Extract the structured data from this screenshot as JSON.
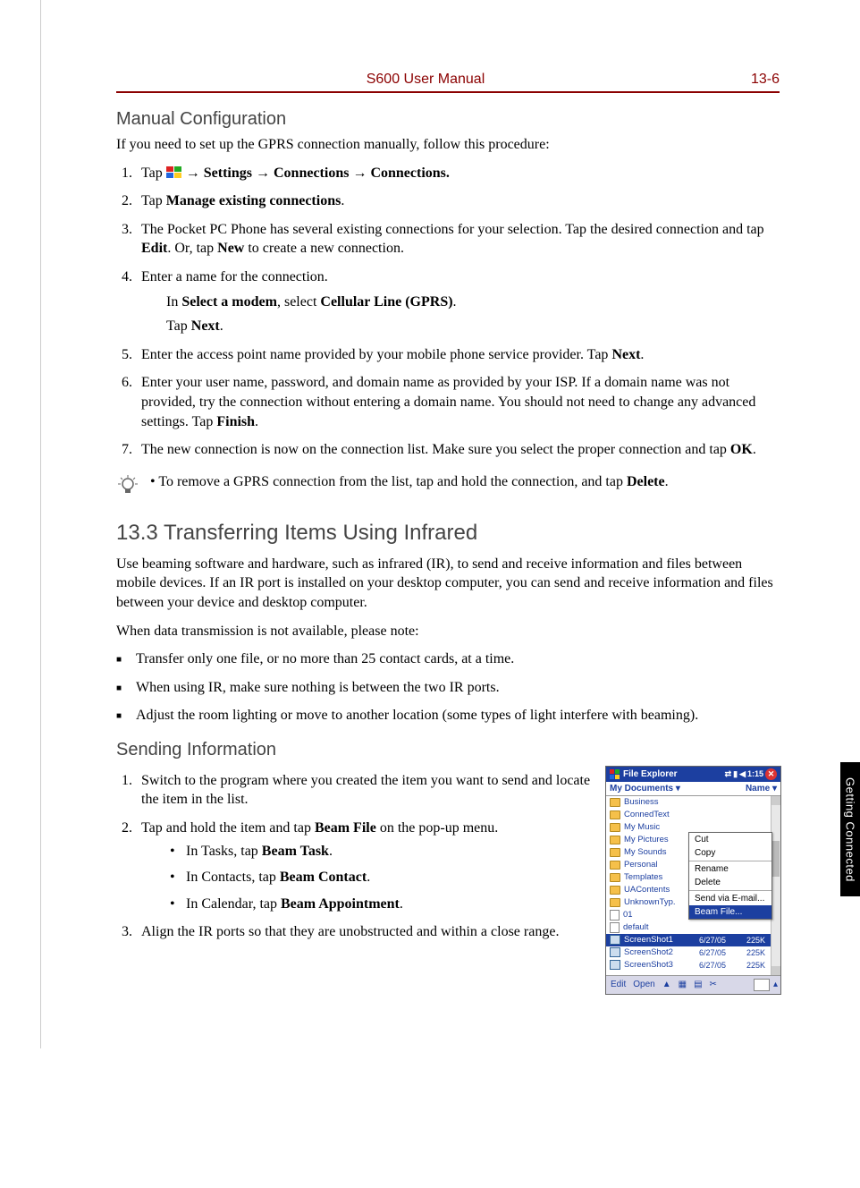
{
  "header": {
    "title": "S600 User Manual",
    "page": "13-6"
  },
  "side_tab": "Getting Connected",
  "manual_config": {
    "heading": "Manual Configuration",
    "intro": "If you need to set up the GPRS connection manually, follow this procedure:",
    "steps": {
      "s1_pre": "Tap ",
      "s1_post": " → Settings → Connections → Connections.",
      "s2_pre": "Tap ",
      "s2_bold": "Manage existing connections",
      "s2_post": ".",
      "s3a": "The Pocket PC Phone has several existing connections for your selection. Tap the desired connection and tap ",
      "s3b": "Edit",
      "s3c": ". Or, tap ",
      "s3d": "New",
      "s3e": " to create a new connection.",
      "s4": "Enter a name for the connection.",
      "s4_in1a": "In ",
      "s4_in1b": "Select a modem",
      "s4_in1c": ", select ",
      "s4_in1d": "Cellular Line (GPRS)",
      "s4_in1e": ".",
      "s4_in2a": "Tap ",
      "s4_in2b": "Next",
      "s4_in2c": ".",
      "s5a": "Enter the access point name provided by your mobile phone service provider. Tap ",
      "s5b": "Next",
      "s5c": ".",
      "s6a": "Enter your user name, password, and domain name as provided by your ISP. If a domain name was not provided, try the connection without entering a domain name. You should not need to change any advanced settings. Tap ",
      "s6b": "Finish",
      "s6c": ".",
      "s7a": "The new connection is now on the connection list. Make sure you select the proper connection and tap ",
      "s7b": "OK",
      "s7c": "."
    },
    "tip_a": "•    To remove a GPRS connection from the list, tap and hold the connection, and tap ",
    "tip_b": "Delete",
    "tip_c": "."
  },
  "section13_3": {
    "heading": "13.3    Transferring Items Using Infrared",
    "p1": "Use beaming software and hardware, such as infrared (IR), to send and receive information and files between mobile devices. If an IR port is installed on your desktop computer, you can send and receive information and files between your device and desktop computer.",
    "p2": "When data transmission is not available, please note:",
    "bullets": [
      "Transfer only one file, or no more than 25 contact cards, at a time.",
      "When using IR, make sure nothing is between the two IR ports.",
      "Adjust the room lighting or move to another location (some types of light interfere with beaming)."
    ]
  },
  "sending": {
    "heading": "Sending Information",
    "s1": "Switch to the program where you created the item you want to send and locate the item in the list.",
    "s2a": "Tap and hold the item and tap ",
    "s2b": "Beam File",
    "s2c": " on the pop-up menu.",
    "sub": {
      "t1a": "In Tasks, tap ",
      "t1b": "Beam Task",
      "t1c": ".",
      "t2a": "In Contacts, tap ",
      "t2b": "Beam Contact",
      "t2c": ".",
      "t3a": "In Calendar, tap ",
      "t3b": "Beam Appointment",
      "t3c": "."
    },
    "s3": "Align the IR ports so that they are unobstructed and within a close range."
  },
  "device": {
    "title": "File Explorer",
    "time": "1:15",
    "toolbar_left": "My Documents ▾",
    "toolbar_right": "Name ▾",
    "folders": [
      "Business",
      "ConnedText",
      "My Music",
      "My Pictures",
      "My Sounds",
      "Personal",
      "Templates",
      "UAContents",
      "UnknownTyp."
    ],
    "files": [
      {
        "icon": "file",
        "name": "01",
        "date": "",
        "size": ""
      },
      {
        "icon": "file",
        "name": "default",
        "date": "",
        "size": ""
      },
      {
        "icon": "img",
        "name": "ScreenShot1",
        "date": "6/27/05",
        "size": "225K",
        "selected": true
      },
      {
        "icon": "img",
        "name": "ScreenShot2",
        "date": "6/27/05",
        "size": "225K"
      },
      {
        "icon": "img",
        "name": "ScreenShot3",
        "date": "6/27/05",
        "size": "225K"
      }
    ],
    "context_menu": [
      "Cut",
      "Copy",
      "",
      "Rename",
      "Delete",
      "",
      "Send via E-mail...",
      "Beam File..."
    ],
    "context_selected": "Beam File...",
    "bottom": {
      "edit": "Edit",
      "open": "Open",
      "arrow": "▲"
    }
  }
}
